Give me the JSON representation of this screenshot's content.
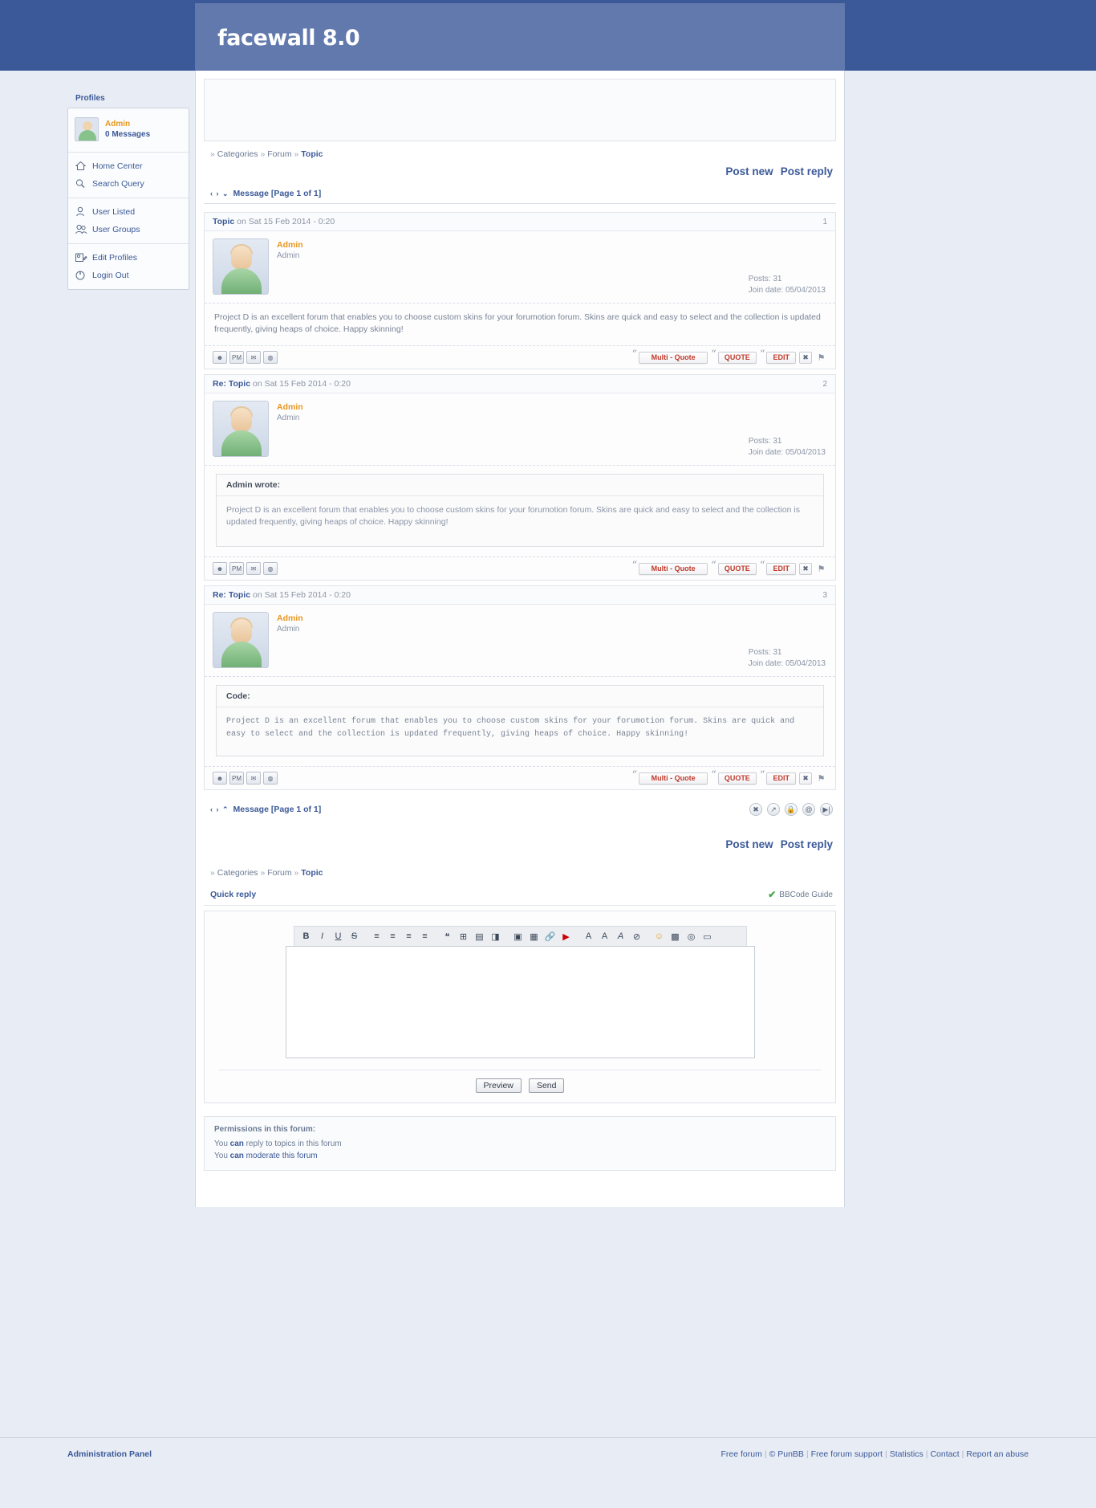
{
  "header": {
    "logo": "facewall 8.0"
  },
  "sidebar": {
    "title": "Profiles",
    "user": {
      "name": "Admin",
      "messages": "0 Messages"
    },
    "groups": [
      {
        "items": [
          {
            "label": "Home Center",
            "icon": "home-icon"
          },
          {
            "label": "Search Query",
            "icon": "search-icon"
          }
        ]
      },
      {
        "items": [
          {
            "label": "User Listed",
            "icon": "user-icon"
          },
          {
            "label": "User Groups",
            "icon": "users-icon"
          }
        ]
      },
      {
        "items": [
          {
            "label": "Edit Profiles",
            "icon": "edit-profile-icon"
          },
          {
            "label": "Login Out",
            "icon": "power-icon"
          }
        ]
      }
    ]
  },
  "breadcrumb": {
    "sep": "»",
    "items": [
      "Categories",
      "Forum"
    ],
    "current": "Topic"
  },
  "actions": {
    "post_new": "Post new",
    "post_reply": "Post reply"
  },
  "message_bar": {
    "glyphs": "‹ › ⌄",
    "glyphs_up": "‹ › ⌃",
    "label": "Message [Page 1 of 1]",
    "icons": [
      "close-icon",
      "share-icon",
      "lock-icon",
      "at-icon",
      "last-page-icon"
    ]
  },
  "posts": [
    {
      "subject": "Topic",
      "date": "on Sat 15 Feb 2014 - 0:20",
      "number": "1",
      "author": "Admin",
      "rank": "Admin",
      "posts_count": "Posts: 31",
      "join_date": "Join date: 05/04/2013",
      "type": "text",
      "body": "Project D is an excellent forum that enables you to choose custom skins for your forumotion forum. Skins are quick and easy to select and the collection is updated frequently, giving heaps of choice. Happy skinning!"
    },
    {
      "subject": "Re: Topic",
      "date": "on Sat 15 Feb 2014 - 0:20",
      "number": "2",
      "author": "Admin",
      "rank": "Admin",
      "posts_count": "Posts: 31",
      "join_date": "Join date: 05/04/2013",
      "type": "quote",
      "quote_head": "Admin wrote:",
      "body": "Project D is an excellent forum that enables you to choose custom skins for your forumotion forum. Skins are quick and easy to select and the collection is updated frequently, giving heaps of choice. Happy skinning!"
    },
    {
      "subject": "Re: Topic",
      "date": "on Sat 15 Feb 2014 - 0:20",
      "number": "3",
      "author": "Admin",
      "rank": "Admin",
      "posts_count": "Posts: 31",
      "join_date": "Join date: 05/04/2013",
      "type": "code",
      "quote_head": "Code:",
      "body": "Project D is an excellent forum that enables you to choose custom skins for your forumotion forum. Skins are quick and easy to select and the collection is updated frequently, giving heaps of choice. Happy skinning!"
    }
  ],
  "post_buttons": {
    "multi_quote": "Multi - Quote",
    "quote": "QUOTE",
    "edit": "EDIT",
    "delete": "✖",
    "report": "⚑"
  },
  "post_icons": [
    "profile-icon",
    "pm-icon",
    "email-icon",
    "website-icon"
  ],
  "quick_reply": {
    "title": "Quick reply",
    "bbcode_guide": "BBCode Guide",
    "textarea_value": "",
    "textarea_placeholder": "",
    "preview": "Preview",
    "send": "Send"
  },
  "toolbar": [
    "bold-icon",
    "italic-icon",
    "underline-icon",
    "strikethrough-icon",
    "align-left-icon",
    "align-center-icon",
    "align-right-icon",
    "justify-icon",
    "quote-icon",
    "code-icon",
    "spoiler-icon",
    "hide-icon",
    "image-icon",
    "flash-icon",
    "link-icon",
    "youtube-icon",
    "font-color-icon",
    "font-size-icon",
    "font-face-icon",
    "clear-format-icon",
    "smiley-icon",
    "calendar-icon",
    "search-web-icon",
    "page-icon"
  ],
  "permissions": {
    "title": "Permissions in this forum:",
    "lines": [
      {
        "pre": "You ",
        "strong": "can",
        "post": " reply to topics in this forum",
        "link": ""
      },
      {
        "pre": "You ",
        "strong": "can",
        "post": " ",
        "link": "moderate this forum"
      }
    ]
  },
  "footer": {
    "left": "Administration Panel",
    "right": [
      "Free forum",
      "© PunBB",
      "Free forum support",
      "Statistics",
      "Contact",
      "Report an abuse"
    ]
  },
  "colors": {
    "brand": "#3b5998",
    "brand_light": "#6179ad",
    "accent_orange": "#e8961e",
    "accent_red": "#c0392b"
  }
}
